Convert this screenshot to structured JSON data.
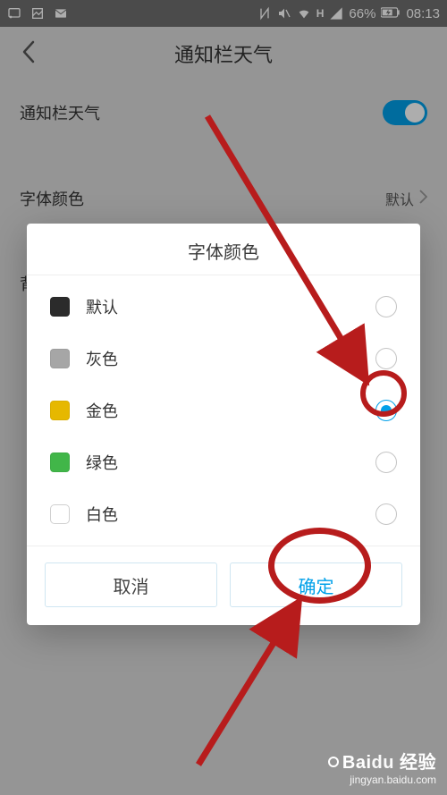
{
  "status": {
    "battery_text": "66%",
    "time": "08:13",
    "net_letter": "H"
  },
  "header": {
    "title": "通知栏天气"
  },
  "settings": {
    "toggle_label": "通知栏天气",
    "font_color_label": "字体颜色",
    "font_color_value": "默认",
    "bg_label_partial": "背"
  },
  "dialog": {
    "title": "字体颜色",
    "options": [
      {
        "label": "默认"
      },
      {
        "label": "灰色"
      },
      {
        "label": "金色"
      },
      {
        "label": "绿色"
      },
      {
        "label": "白色"
      }
    ],
    "selected_index": 2,
    "cancel": "取消",
    "confirm": "确定"
  },
  "watermark": {
    "brand_suffix": "经验",
    "url": "jingyan.baidu.com"
  }
}
